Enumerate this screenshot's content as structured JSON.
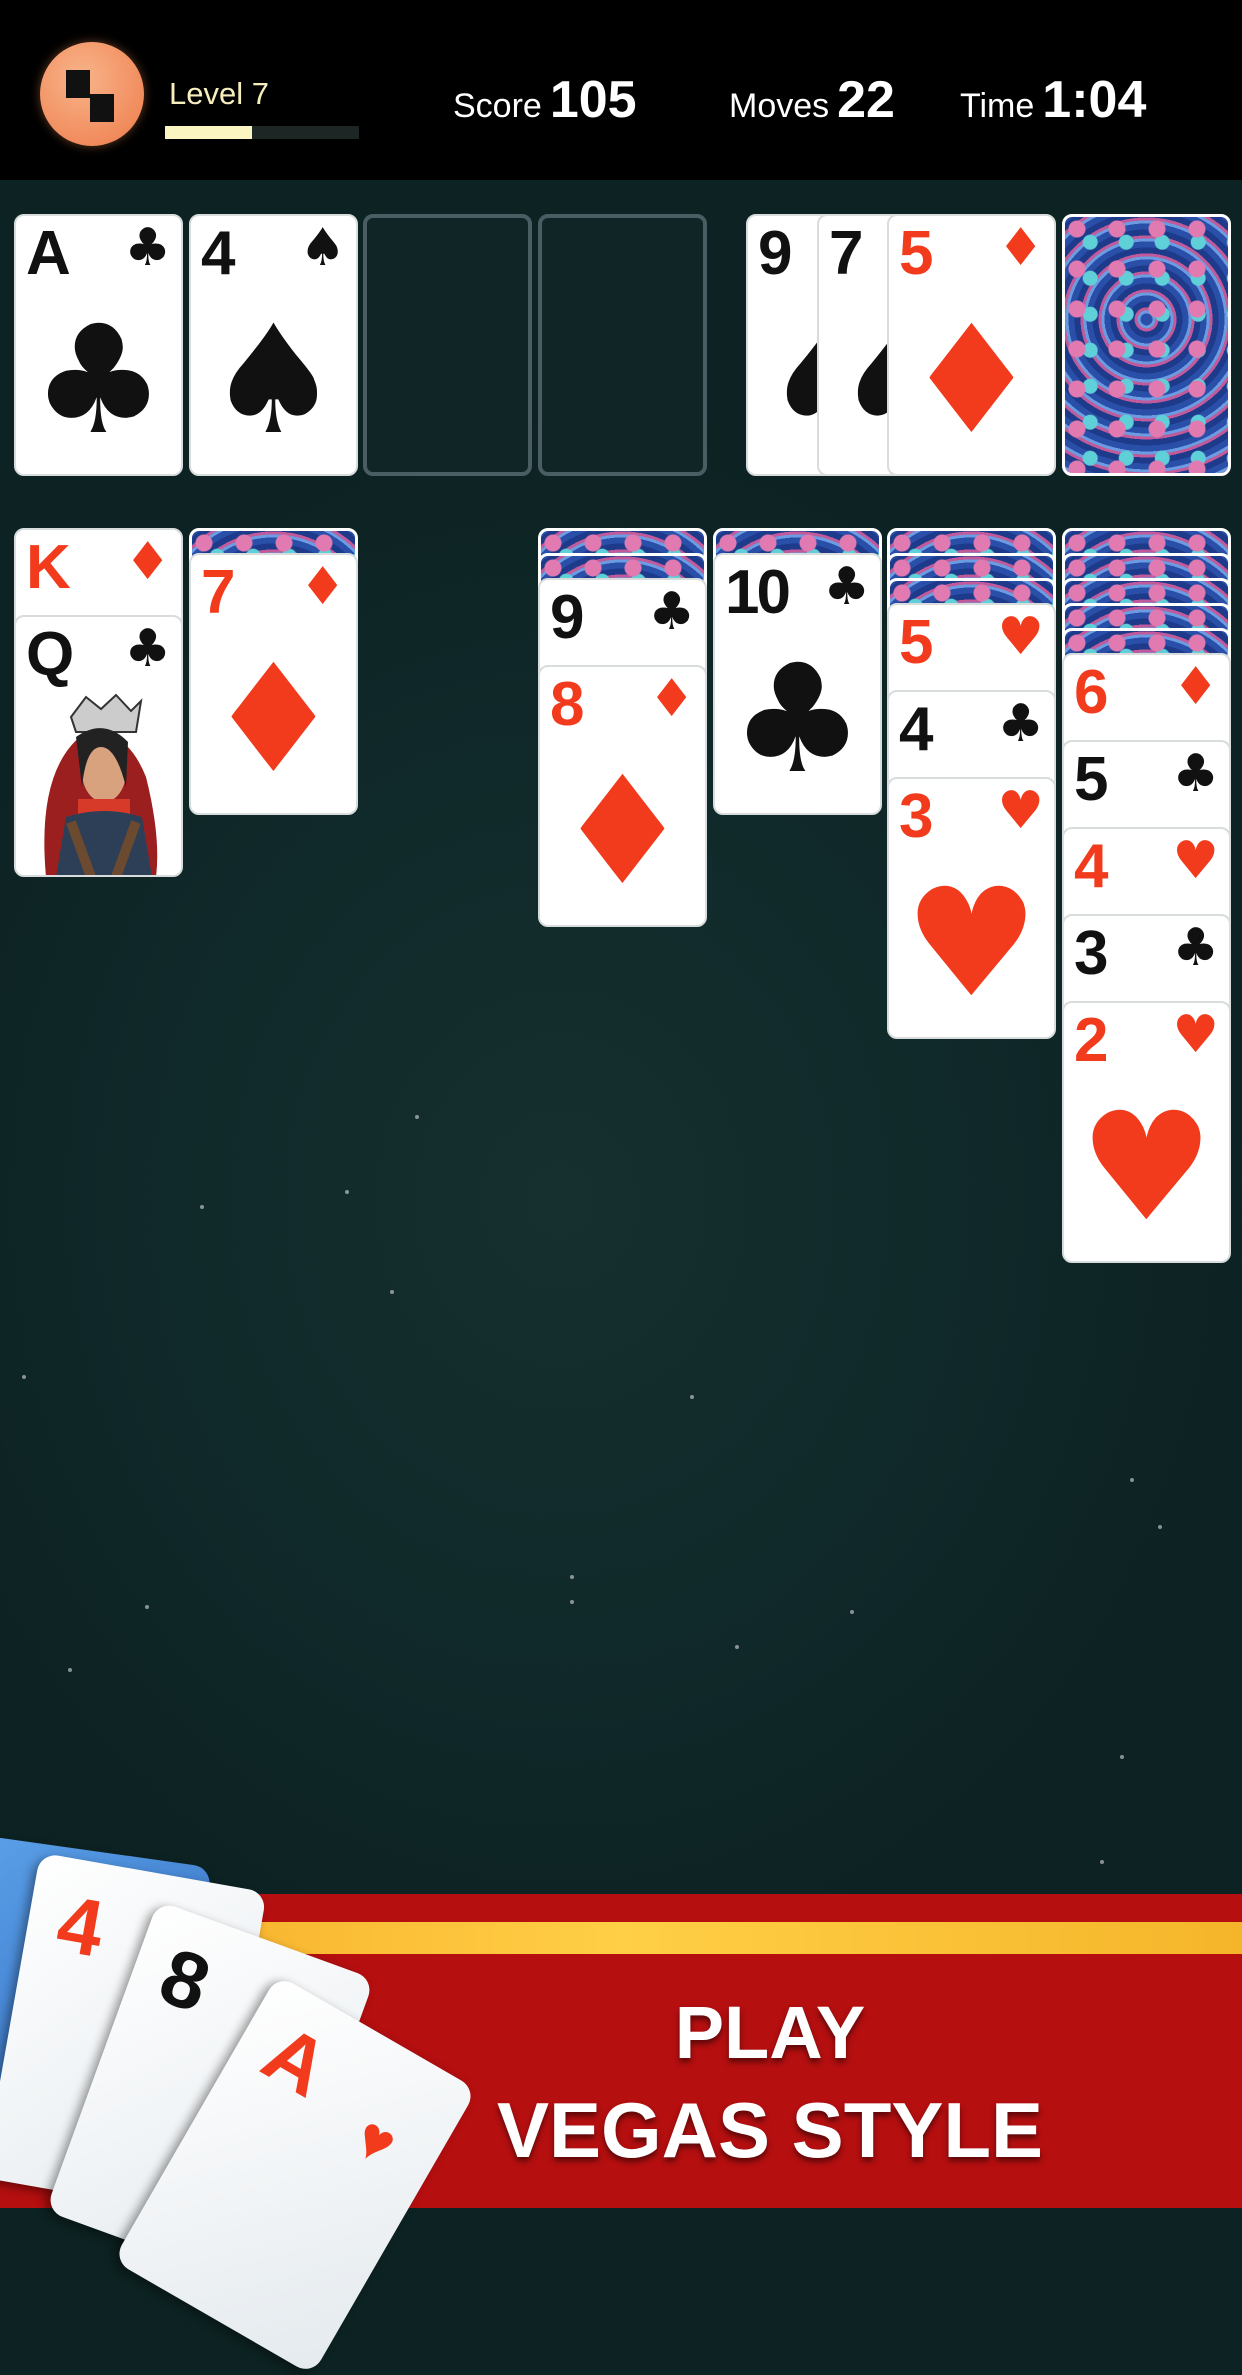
{
  "header": {
    "level_label": "Level 7",
    "level_progress": 0.45,
    "score_label": "Score",
    "score": "105",
    "moves_label": "Moves",
    "moves": "22",
    "time_label": "Time",
    "time": "1:04"
  },
  "colors": {
    "red": "#f23b1c",
    "black": "#111111",
    "banner": "#b50f10",
    "stripe": "#ffc83a"
  },
  "foundations": [
    {
      "rank": "A",
      "suit": "♣"
    },
    {
      "rank": "4",
      "suit": "♠"
    },
    null,
    null
  ],
  "waste": [
    {
      "rank": "9",
      "suit": "♠"
    },
    {
      "rank": "7",
      "suit": "♠"
    },
    {
      "rank": "5",
      "suit": "♦"
    }
  ],
  "stock": {
    "face_down": true
  },
  "tableau": [
    {
      "hidden": 0,
      "cards": [
        {
          "rank": "K",
          "suit": "♦"
        },
        {
          "rank": "Q",
          "suit": "♣",
          "face": true
        }
      ]
    },
    {
      "hidden": 1,
      "cards": [
        {
          "rank": "7",
          "suit": "♦"
        }
      ]
    },
    {
      "hidden": 0,
      "cards": []
    },
    {
      "hidden": 2,
      "cards": [
        {
          "rank": "9",
          "suit": "♣"
        },
        {
          "rank": "8",
          "suit": "♦"
        }
      ]
    },
    {
      "hidden": 1,
      "cards": [
        {
          "rank": "10",
          "suit": "♣"
        }
      ]
    },
    {
      "hidden": 3,
      "cards": [
        {
          "rank": "5",
          "suit": "♥"
        },
        {
          "rank": "4",
          "suit": "♣"
        },
        {
          "rank": "3",
          "suit": "♥"
        }
      ]
    },
    {
      "hidden": 5,
      "cards": [
        {
          "rank": "6",
          "suit": "♦"
        },
        {
          "rank": "5",
          "suit": "♣"
        },
        {
          "rank": "4",
          "suit": "♥"
        },
        {
          "rank": "3",
          "suit": "♣"
        },
        {
          "rank": "2",
          "suit": "♥"
        }
      ]
    }
  ],
  "banner": {
    "line1": "PLAY",
    "line2": "VEGAS STYLE",
    "fan_cards": [
      {
        "rank": "4",
        "suit": "♦"
      },
      {
        "rank": "8",
        "suit": "♣"
      },
      {
        "rank": "A",
        "suit": "♥"
      }
    ]
  }
}
